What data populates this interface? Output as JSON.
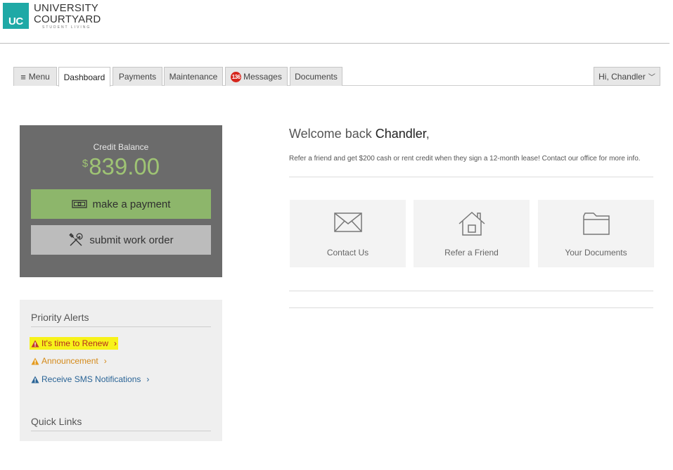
{
  "brand": {
    "mark": "UC",
    "line1": "UNIVERSITY",
    "line2": "COURTYARD",
    "tagline": "STUDENT LIVING",
    "color": "#1fa9a6"
  },
  "tabs": [
    {
      "label": "Menu",
      "icon": "hamburger-icon"
    },
    {
      "label": "Dashboard",
      "active": true
    },
    {
      "label": "Payments"
    },
    {
      "label": "Maintenance"
    },
    {
      "label": "Messages",
      "badge": "136"
    },
    {
      "label": "Documents"
    }
  ],
  "user_menu": {
    "label": "Hi, Chandler",
    "icon": "chevron-down-icon"
  },
  "balance": {
    "label": "Credit Balance",
    "currency": "$",
    "amount": "839.00",
    "amount_color": "#9fc474"
  },
  "actions": {
    "pay_label": "make a payment",
    "pay_icon": "money-icon",
    "work_label": "submit work order",
    "work_icon": "tools-icon"
  },
  "alerts": {
    "heading": "Priority Alerts",
    "items": [
      {
        "label": "It's time to Renew",
        "color": "#b52a1e",
        "highlight": "#f7f21a"
      },
      {
        "label": "Announcement",
        "color": "#d48a1a"
      },
      {
        "label": "Receive SMS Notifications",
        "color": "#2a6496"
      }
    ]
  },
  "quick_links": {
    "heading": "Quick Links"
  },
  "welcome": {
    "prefix": "Welcome back",
    "name": "Chandler",
    "suffix": ",",
    "promo": "Refer a friend and get $200 cash or rent credit when they sign a 12-month lease! Contact our office for more info."
  },
  "tiles": [
    {
      "label": "Contact Us",
      "icon": "envelope-icon"
    },
    {
      "label": "Refer a Friend",
      "icon": "house-icon"
    },
    {
      "label": "Your Documents",
      "icon": "folder-icon"
    }
  ]
}
